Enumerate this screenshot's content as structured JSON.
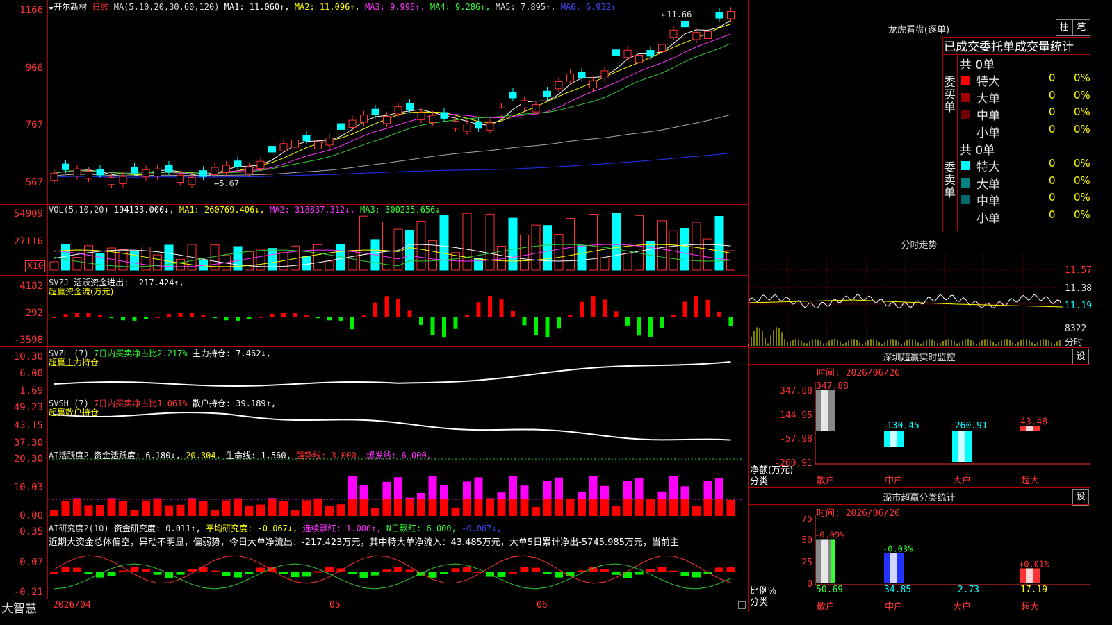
{
  "app": {
    "brand": "大智慧",
    "bottom_date": "2026/04",
    "months": [
      "05",
      "06"
    ]
  },
  "kline": {
    "title": "★开尔新材",
    "period": "日线",
    "ma_params": "MA(5,10,20,30,60,120)",
    "ma1": "MA1: 11.060↑,",
    "ma2": "MA2: 11.096↑,",
    "ma3": "MA3: 9.998↑,",
    "ma4": "MA4: 9.286↑,",
    "ma5": "MA5: 7.895↑,",
    "ma6": "MA6: 6.932↑",
    "y_labels": [
      "1166",
      "966",
      "767",
      "567"
    ],
    "high_mark": "←11.66",
    "low_mark": "←5.67"
  },
  "vol": {
    "title": "VOL(5,10,20)",
    "value": "194133.000↓,",
    "ma1": "MA1: 260769.406↓,",
    "ma2": "MA2: 318837.312↓,",
    "ma3": "MA3: 300235.656↓",
    "y_labels": [
      "54909",
      "27116"
    ],
    "unit": "X10"
  },
  "svzj": {
    "title": "SVZJ",
    "label": "活跃资金进出: -217.424↑,",
    "subtitle": "超赢资金流(万元)",
    "y_labels": [
      "4182",
      "292",
      "-3598"
    ]
  },
  "svzl": {
    "title": "SVZL (7)",
    "label1": "7日内买卖净占比2.217%",
    "label2": "主力持仓: 7.462↓,",
    "subtitle": "超赢主力持仓",
    "y_labels": [
      "10.30",
      "6.00",
      "1.69"
    ]
  },
  "svsh": {
    "title": "SVSH (7)",
    "label1": "7日内买卖净占比1.061%",
    "label2": "散户持仓: 39.189↑,",
    "subtitle": "超赢散户持仓",
    "y_labels": [
      "49.23",
      "43.15",
      "37.30"
    ]
  },
  "ai1": {
    "title": "AI活跃度2",
    "l1": "资金活跃度: 6.180↓,",
    "l2": "20.304,",
    "l3": "生命线: 1.560,",
    "l4": "强势线: 3.000,",
    "l5": "爆发线: 6.000,",
    "y_labels": [
      "20.30",
      "10.03",
      "0.00"
    ]
  },
  "ai2": {
    "title": "AI研究度2(10)",
    "l1": "资金研究度: 0.011↑,",
    "l2": "平均研究度: -0.067↓,",
    "l3": "连续飘红: 1.000↑,",
    "l4": "N日飘红: 6.000,",
    "l5": "-0.067↓,",
    "summary": "近期大资金总体偏空，异动不明显，偏弱势，今日大单净流出：-217.423万元，其中特大单净流入：43.485万元，大单5日累计净出-5745.985万元，当前主",
    "y_labels": [
      "0.35",
      "0.07",
      "-0.21"
    ]
  },
  "longhu": {
    "title": "龙虎看盘(逐单)",
    "btn_zhu": "柱",
    "btn_bi": "笔",
    "tabs": "已成交委托单成交量统计",
    "buy_side": "委买单",
    "sell_side": "委卖单",
    "buy_total": "共 0单",
    "sell_total": "共 0单",
    "buy_rows": [
      {
        "name": "特大",
        "count": "0",
        "pct": "0%",
        "color": "#ff0000"
      },
      {
        "name": "大单",
        "count": "0",
        "pct": "0%",
        "color": "#a00000"
      },
      {
        "name": "中单",
        "count": "0",
        "pct": "0%",
        "color": "#700000"
      },
      {
        "name": "小单",
        "count": "0",
        "pct": "0%",
        "color": ""
      }
    ],
    "sell_rows": [
      {
        "name": "特大",
        "count": "0",
        "pct": "0%",
        "color": "#00ffff"
      },
      {
        "name": "大单",
        "count": "0",
        "pct": "0%",
        "color": "#008080"
      },
      {
        "name": "中单",
        "count": "0",
        "pct": "0%",
        "color": "#006868"
      },
      {
        "name": "小单",
        "count": "0",
        "pct": "0%",
        "color": ""
      }
    ]
  },
  "fenshi": {
    "title": "分时走势",
    "y_labels": [
      "11.57",
      "11.38",
      "11.19"
    ],
    "vol_label": "8322",
    "mode": "分时"
  },
  "monitor": {
    "title": "深圳超赢实时监控",
    "btn": "设",
    "time": "时间: 2026/06/26",
    "y_labels": [
      "347.88",
      "144.95",
      "-57.98",
      "-260.91"
    ],
    "ylabel": "净额(万元)",
    "xlabel": "分类",
    "categories": [
      "散户",
      "中户",
      "大户",
      "超大"
    ],
    "values": [
      "347.88",
      "-130.45",
      "-260.91",
      "43.48"
    ]
  },
  "stats": {
    "title": "深市超赢分类统计",
    "btn": "设",
    "time": "时间: 2026/06/26",
    "y_labels": [
      "75",
      "50",
      "25",
      "0"
    ],
    "ylabel": "比例%",
    "xlabel": "分类",
    "categories": [
      "散户",
      "中户",
      "大户",
      "超大"
    ],
    "pct_top": [
      "+0.09%",
      "-0.03%",
      "",
      "+0.01%"
    ],
    "values": [
      "50.69",
      "34.85",
      "-2.73",
      "17.19"
    ]
  }
}
